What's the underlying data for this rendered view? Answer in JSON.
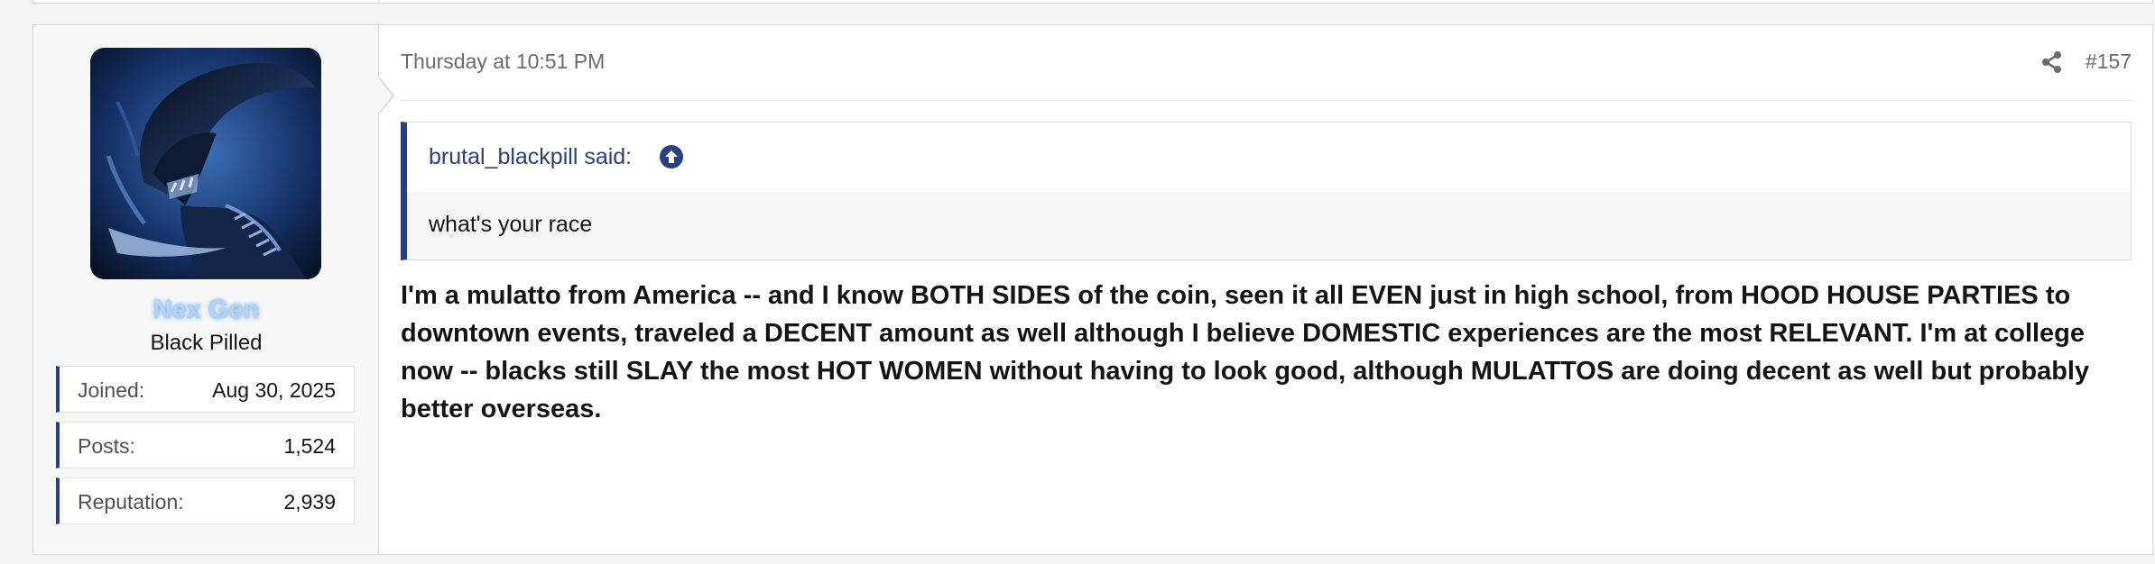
{
  "user": {
    "name": "Nex Gen",
    "title": "Black Pilled",
    "stats": [
      {
        "label": "Joined:",
        "value": "Aug 30, 2025"
      },
      {
        "label": "Posts:",
        "value": "1,524"
      },
      {
        "label": "Reputation:",
        "value": "2,939"
      }
    ]
  },
  "post": {
    "date": "Thursday at 10:51 PM",
    "number": "#157",
    "share_icon": "share-icon",
    "quote": {
      "author": "brutal_blackpill said:",
      "expand_icon": "arrow-up-circle-icon",
      "text": "what's your race"
    },
    "message": "I'm a mulatto from America -- and I know BOTH SIDES of the coin, seen it all EVEN just in high school, from HOOD HOUSE PARTIES to downtown events, traveled a DECENT amount as well although I believe DOMESTIC experiences are the most RELEVANT. I'm at college now -- blacks still SLAY the most HOT WOMEN without having to look good, although MULATTOS are doing decent as well but probably better overseas."
  },
  "colors": {
    "accent": "#2a3f7d",
    "username_glow": "#6fa8e8",
    "background": "#f4f4f4"
  }
}
